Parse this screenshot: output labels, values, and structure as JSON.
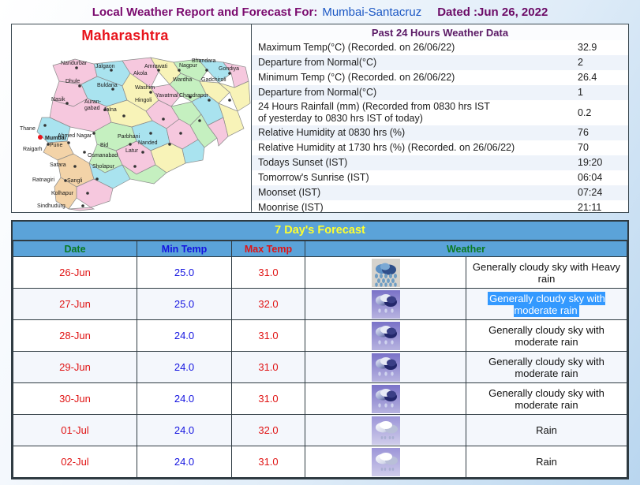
{
  "title": {
    "main": "Local Weather Report and Forecast For:",
    "station": "Mumbai-Santacruz",
    "dated": "Dated :Jun 26, 2022"
  },
  "map": {
    "title": "Maharashtra",
    "highlighted_city": "Mumbai",
    "districts": [
      "Nandurbar",
      "Jalgaon",
      "Dhule",
      "Amrawati",
      "Bhandara",
      "Nagpur",
      "Gondiya",
      "Buldana",
      "Akola",
      "Wardha",
      "Nasik",
      "Washim",
      "Auran-",
      "gabad",
      "Yavatmal",
      "Gadchiroli",
      "Jalna",
      "Hingoli",
      "Chandrapur",
      "Thane",
      "Ahmed Nagar",
      "Parbhani",
      "Mumbai",
      "Bid",
      "Nanded",
      "Pune",
      "Latur",
      "Raigarh",
      "Osmanabad",
      "Satara",
      "Sholapur",
      "Ratnagiri",
      "Sangli",
      "Kolhapur",
      "Sindhudurg"
    ]
  },
  "past24": {
    "heading": "Past 24 Hours Weather Data",
    "rows": [
      {
        "label": "Maximum Temp(°C) (Recorded. on 26/06/22)",
        "value": "32.9"
      },
      {
        "label": "Departure from Normal(°C)",
        "value": "2"
      },
      {
        "label": "Minimum Temp (°C) (Recorded. on 26/06/22)",
        "value": "26.4"
      },
      {
        "label": "Departure from Normal(°C)",
        "value": "1"
      },
      {
        "label": "24 Hours Rainfall (mm) (Recorded from 0830 hrs IST",
        "label2": "of yesterday to 0830 hrs IST of today)",
        "value": "0.2"
      },
      {
        "label": "Relative Humidity at 0830 hrs (%)",
        "value": "76"
      },
      {
        "label": "Relative Humidity at 1730 hrs (%) (Recorded. on 26/06/22)",
        "value": "70"
      },
      {
        "label": "Todays Sunset (IST)",
        "value": "19:20"
      },
      {
        "label": "Tomorrow's Sunrise (IST)",
        "value": "06:04"
      },
      {
        "label": "Moonset (IST)",
        "value": "07:24"
      },
      {
        "label": "Moonrise (IST)",
        "value": "21:11"
      }
    ]
  },
  "forecast": {
    "title": "7 Day's Forecast",
    "columns": {
      "date": "Date",
      "min": "Min Temp",
      "max": "Max Temp",
      "weather": "Weather"
    },
    "rows": [
      {
        "date": "26-Jun",
        "min": "25.0",
        "max": "31.0",
        "weather": "Generally cloudy sky with Heavy rain",
        "icon": "heavy-rain-icon",
        "selected": false
      },
      {
        "date": "27-Jun",
        "min": "25.0",
        "max": "32.0",
        "weather": "Generally cloudy sky with moderate rain",
        "icon": "moderate-rain-icon",
        "selected": true
      },
      {
        "date": "28-Jun",
        "min": "24.0",
        "max": "31.0",
        "weather": "Generally cloudy sky with moderate rain",
        "icon": "moderate-rain-icon",
        "selected": false
      },
      {
        "date": "29-Jun",
        "min": "24.0",
        "max": "31.0",
        "weather": "Generally cloudy sky with moderate rain",
        "icon": "moderate-rain-icon",
        "selected": false
      },
      {
        "date": "30-Jun",
        "min": "24.0",
        "max": "31.0",
        "weather": "Generally cloudy sky with moderate rain",
        "icon": "moderate-rain-icon",
        "selected": false
      },
      {
        "date": "01-Jul",
        "min": "24.0",
        "max": "32.0",
        "weather": "Rain",
        "icon": "rain-icon",
        "selected": false
      },
      {
        "date": "02-Jul",
        "min": "24.0",
        "max": "31.0",
        "weather": "Rain",
        "icon": "rain-icon",
        "selected": false
      }
    ]
  },
  "colors": {
    "title_purple": "#7a0a6e",
    "title_blue": "#1b57c4",
    "header_blue": "#5ba3d9",
    "header_yellow": "#ffff2e",
    "date_red": "#e01414",
    "min_blue": "#1414e0",
    "green": "#0a7a22",
    "selection_blue": "#3399ff",
    "map_red": "#e8141c"
  }
}
